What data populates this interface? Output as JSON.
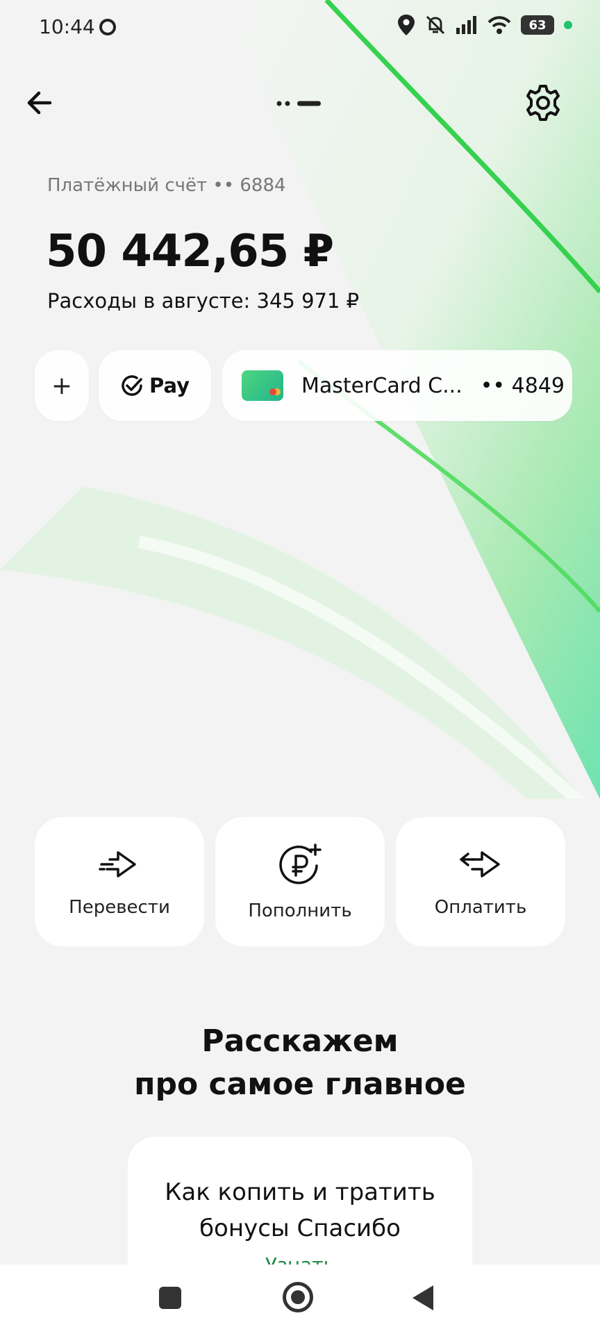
{
  "status_bar": {
    "time": "10:44",
    "battery": "63",
    "icons": [
      "chat-icon",
      "location-icon",
      "bell-off-icon",
      "signal-icon",
      "wifi-icon",
      "battery-icon"
    ]
  },
  "header": {
    "back_icon": "arrow-left-icon",
    "settings_icon": "gear-icon"
  },
  "account": {
    "label": "Платёжный счёт •• 6884",
    "balance": "50 442,65 ₽",
    "expenses": "Расходы в августе: 345 971 ₽"
  },
  "chips": {
    "add": "+",
    "pay": "Pay",
    "card_name": "MasterCard C...",
    "card_number": "•• 4849"
  },
  "actions": [
    {
      "label": "Перевести",
      "icon": "transfer-arrow-icon"
    },
    {
      "label": "Пополнить",
      "icon": "ruble-plus-icon"
    },
    {
      "label": "Оплатить",
      "icon": "exchange-arrows-icon"
    }
  ],
  "section": {
    "title_line1": "Расскажем",
    "title_line2": "про самое главное"
  },
  "promo": {
    "line1": "Как копить и тратить",
    "line2": "бонусы Спасибо",
    "link": "Узнать"
  },
  "colors": {
    "accent": "#21c36b",
    "background": "#f3f3f3",
    "link": "#1d8a45"
  }
}
